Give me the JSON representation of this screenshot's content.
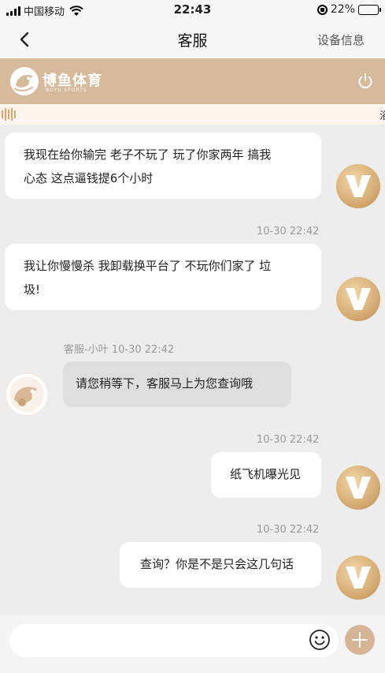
{
  "status_bar": {
    "carrier": "中国移动",
    "time": "22:43",
    "battery": "22%",
    "battery_level": 0.22
  },
  "nav": {
    "back_icon": "chevron-left-icon",
    "title": "客服",
    "right_label": "设备信息"
  },
  "brand": {
    "name": "博鱼体育",
    "subtitle": "BOYU SPORTS",
    "logo_icon": "fish-logo-icon",
    "power_icon": "power-icon"
  },
  "marquee": {
    "text": "浴"
  },
  "messages": [
    {
      "side": "right",
      "text_line1": "我现在给你输完 老子不玩了 玩了你家两年 搞我",
      "text_line2": "心态 这点逼钱提6个小时"
    },
    {
      "side": "right",
      "time": "10-30 22:42",
      "text_line1": "我让你慢慢杀 我卸载换平台了 不玩你们家了 垃",
      "text_line2": "圾!"
    },
    {
      "side": "left",
      "sender": "客服-小叶 10-30 22:42",
      "text": "请您稍等下，客服马上为您查询哦"
    },
    {
      "side": "right",
      "time": "10-30 22:42",
      "text": "纸飞机曝光见"
    },
    {
      "side": "right",
      "time": "10-30 22:42",
      "text": "查询？你是不是只会这几句话"
    }
  ],
  "input": {
    "placeholder": "",
    "emoji_icon": "smiley-icon",
    "plus_icon": "plus-icon"
  },
  "colors": {
    "brand": "#d7b99c",
    "avatar_gold": "#d9b078",
    "plus_button": "#d6b597"
  }
}
